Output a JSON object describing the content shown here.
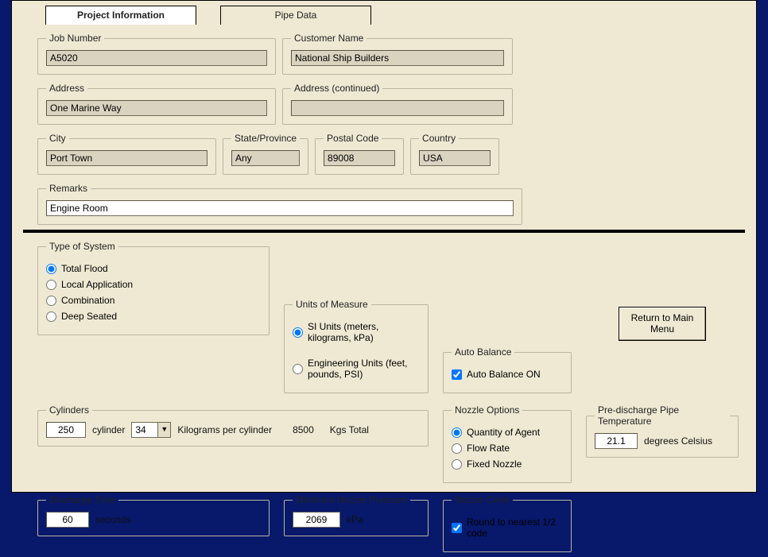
{
  "tabs": {
    "project_info": "Project Information",
    "pipe_data": "Pipe Data"
  },
  "labels": {
    "job_number": "Job Number",
    "customer_name": "Customer Name",
    "address": "Address",
    "address_cont": "Address (continued)",
    "city": "City",
    "state": "State/Province",
    "postal": "Postal Code",
    "country": "Country",
    "remarks": "Remarks",
    "cylinders": "Cylinders",
    "cylinder_word": "cylinder",
    "kg_per_cyl": "Kilograms per cylinder",
    "kgs_total": "Kgs Total",
    "pre_discharge": "Pre-discharge Pipe Temperature",
    "degrees_c": "degrees Celsius",
    "discharge_time": "Discharge Time",
    "seconds": "seconds",
    "units_of_measure": "Units of Measure",
    "si_units": "SI Units (meters, kilograms, kPa)",
    "eng_units": "Engineering Units (feet, pounds, PSI)",
    "nozzle_code": "Nozzle Code",
    "round_half": "Round to nearest 1/2 code",
    "type_of_system": "Type of System",
    "total_flood": "Total Flood",
    "local_app": "Local Application",
    "combination": "Combination",
    "deep_seated": "Deep Seated",
    "auto_balance": "Auto Balance",
    "auto_balance_on": "Auto Balance ON",
    "nozzle_options": "Nozzle Options",
    "qty_agent": "Quantity of Agent",
    "flow_rate": "Flow Rate",
    "fixed_nozzle": "Fixed Nozzle",
    "min_nozzle_pressure": "Minimum Nozzle Pressure",
    "kpa": "kPa",
    "return_main": "Return to Main Menu"
  },
  "values": {
    "job_number": "A5020",
    "customer_name": "National Ship Builders",
    "address": "One Marine Way",
    "address_cont": "",
    "city": "Port Town",
    "state": "Any",
    "postal": "89008",
    "country": "USA",
    "remarks": "Engine Room",
    "cylinders": "250",
    "kg_per_cyl_select": "34",
    "kgs_total": "8500",
    "predischarge_temp": "21.1",
    "discharge_time": "60",
    "min_nozzle_pressure": "2069"
  }
}
